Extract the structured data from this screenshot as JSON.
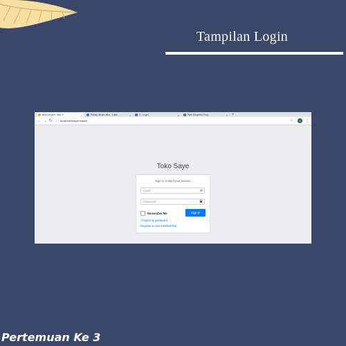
{
  "slide": {
    "title": "Tampilan Login",
    "footer": "Pertemuan Ke 3"
  },
  "browser": {
    "tabs": [
      {
        "label": "Bikin project Toko S",
        "color": "#e8a33a",
        "active": true
      },
      {
        "label": "Rekap absen Mhs - Labs",
        "color": "#3a6ee8",
        "active": false
      },
      {
        "label": "3 - Login",
        "color": "#3a6ee8",
        "active": false
      },
      {
        "label": "Web Ekspresi Prog",
        "color": "#2d8f4e",
        "active": false
      }
    ],
    "url": "localhost/tsaye/masuk",
    "profile_initial": "S"
  },
  "login": {
    "app_title": "Toko Saye",
    "message": "Sign in to start your session",
    "email_placeholder": "Email",
    "password_placeholder": "Password",
    "remember_label": "Remember Me",
    "signin_label": "Sign In",
    "forgot_label": "I forgot my password",
    "register_label": "Register a new membership"
  },
  "icons": {
    "email": "envelope-icon",
    "password": "lock-icon"
  },
  "colors": {
    "background": "#3b476a",
    "accent": "#007bff"
  }
}
